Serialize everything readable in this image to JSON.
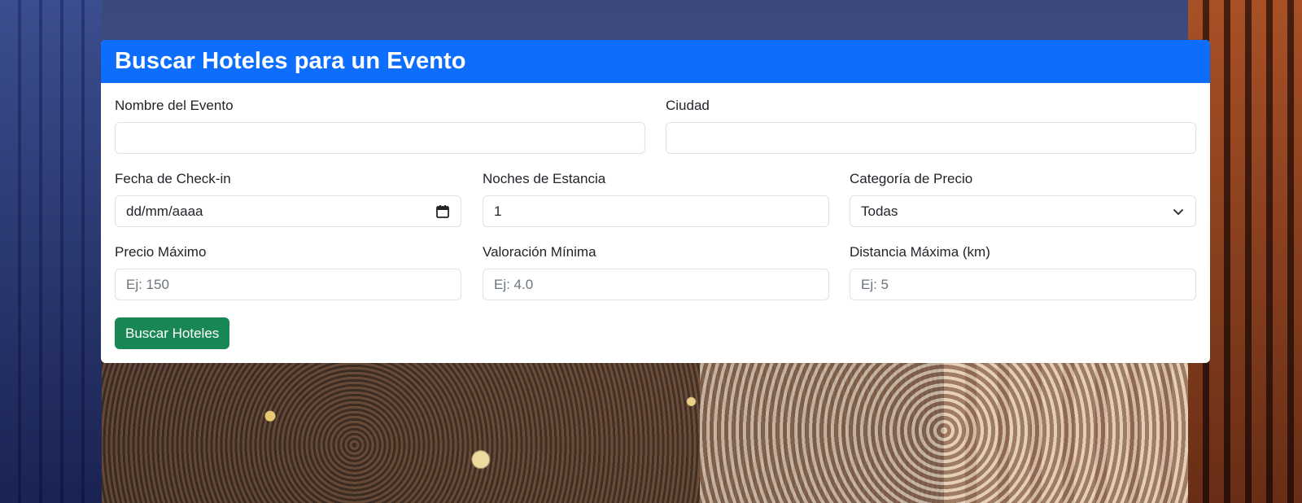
{
  "form": {
    "title": "Buscar Hoteles para un Evento",
    "fields": {
      "event_name": {
        "label": "Nombre del Evento",
        "value": "",
        "placeholder": ""
      },
      "city": {
        "label": "Ciudad",
        "value": "",
        "placeholder": ""
      },
      "checkin_date": {
        "label": "Fecha de Check-in",
        "display": "dd/mm/aaaa"
      },
      "nights": {
        "label": "Noches de Estancia",
        "value": "1"
      },
      "price_category": {
        "label": "Categoría de Precio",
        "selected": "Todas"
      },
      "max_price": {
        "label": "Precio Máximo",
        "placeholder": "Ej: 150"
      },
      "min_rating": {
        "label": "Valoración Mínima",
        "placeholder": "Ej: 4.0"
      },
      "max_distance": {
        "label": "Distancia Máxima (km)",
        "placeholder": "Ej: 5"
      }
    },
    "submit_label": "Buscar Hoteles"
  },
  "colors": {
    "header": "#0d6efd",
    "submit": "#198754"
  },
  "icons": {
    "date": "calendar-icon",
    "select": "chevron-down-icon"
  }
}
